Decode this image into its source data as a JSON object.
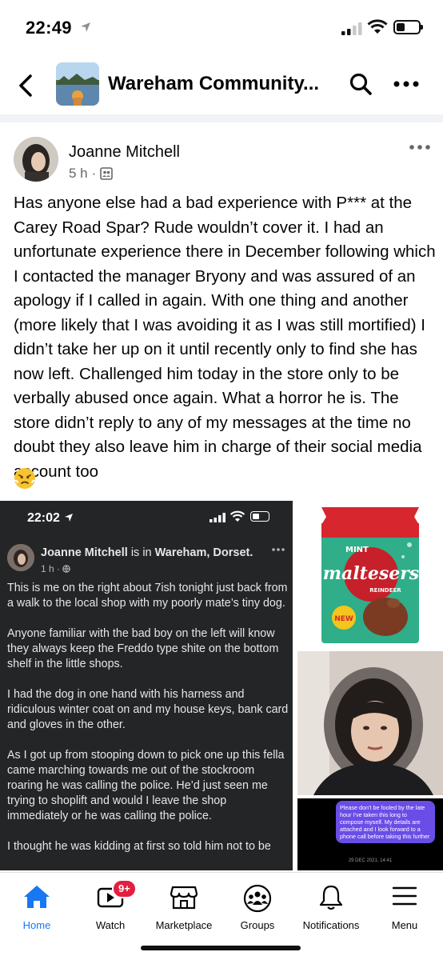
{
  "status_bar": {
    "time": "22:49"
  },
  "header": {
    "group_name": "Wareham Community..."
  },
  "post": {
    "author": "Joanne Mitchell",
    "time_ago": "5 h",
    "text": "Has anyone else had a bad experience with P*** at the Carey Road Spar? Rude wouldn’t cover it. I had an unfortunate experience there in December following which I contacted the manager Bryony and was assured of an apology if I called in again. With one thing and another (more likely that I was avoiding it as I was still mortified) I didn’t take her up on it until recently only to find she has now left. Challenged him today in the store only to be verbally abused once again. What a horror he is. The store didn’t reply to any of my messages at the time no doubt they also leave him in charge of their social media account too",
    "emoji": "😤"
  },
  "embedded_screenshot": {
    "time": "22:02",
    "author": "Joanne Mitchell",
    "is_in": "is in",
    "location": "Wareham, Dorset.",
    "time_ago": "1 h ·",
    "paragraphs": [
      "This is me on the right about 7ish tonight just back from a walk to the local shop with my poorly mate’s tiny dog.",
      "Anyone familiar with the bad boy on the left will know they always keep the Freddo type shite on the bottom shelf in the little shops.",
      "I had the dog in one hand with his harness and ridiculous winter coat on and my house keys, bank card and gloves in the other.",
      "As I got up from stooping down to pick one up this fella came marching towards me out of the stockroom roaring he was calling the police. He’d just seen me trying to shoplift and would I leave the shop immediately or he was calling the police.",
      " I thought he was kidding at first so told him not to be"
    ]
  },
  "candy_image": {
    "brand": "maltesers",
    "flavor": "MINT",
    "sub": "REINDEER",
    "badge": "NEW"
  },
  "message_image": {
    "text": "Please don’t be fooled by the late hour I’ve taken this long to compose myself. My details are attached and I look forward to a phone call before taking this further",
    "date": "29 DEC 2021, 14:41"
  },
  "tabbar": {
    "home": "Home",
    "watch": "Watch",
    "watch_badge": "9+",
    "marketplace": "Marketplace",
    "groups": "Groups",
    "notifications": "Notifications",
    "menu": "Menu"
  },
  "colors": {
    "accent": "#1877f2",
    "badge": "#e41e3f",
    "dark_bg": "#242526",
    "bubble": "#6a4de6"
  }
}
